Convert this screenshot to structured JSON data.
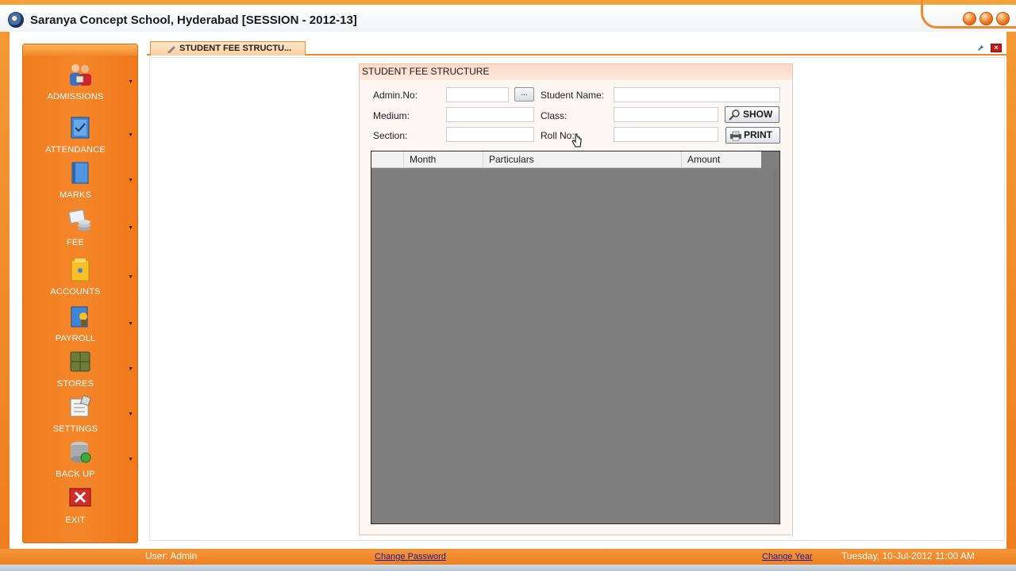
{
  "window": {
    "title": "Saranya Concept School, Hyderabad [SESSION - 2012-13]"
  },
  "sidebar": {
    "items": [
      {
        "label": "ADMISSIONS",
        "icon": "people-icon"
      },
      {
        "label": "ATTENDANCE",
        "icon": "attendance-book-icon"
      },
      {
        "label": "MARKS",
        "icon": "marks-book-icon"
      },
      {
        "label": "FEE",
        "icon": "fee-coins-icon"
      },
      {
        "label": "ACCOUNTS",
        "icon": "accounts-folder-icon"
      },
      {
        "label": "PAYROLL",
        "icon": "payroll-icon"
      },
      {
        "label": "STORES",
        "icon": "stores-cabinet-icon"
      },
      {
        "label": "SETTINGS",
        "icon": "settings-icon"
      },
      {
        "label": "BACK UP",
        "icon": "backup-database-icon"
      },
      {
        "label": "EXIT",
        "icon": "exit-icon"
      }
    ]
  },
  "tabs": [
    {
      "label": "STUDENT FEE STRUCTU..."
    }
  ],
  "form": {
    "title": "STUDENT FEE STRUCTURE",
    "admin_no_label": "Admin.No:",
    "admin_no_value": "",
    "browse_label": "...",
    "student_name_label": "Student Name:",
    "student_name_value": "",
    "medium_label": "Medium:",
    "medium_value": "",
    "class_label": "Class:",
    "class_value": "",
    "section_label": "Section:",
    "section_value": "",
    "roll_no_label": "Roll No:",
    "roll_no_value": "",
    "show_label": "SHOW",
    "print_label": "PRINT"
  },
  "grid": {
    "columns": [
      "Month",
      "Particulars",
      "Amount"
    ],
    "rows": []
  },
  "status": {
    "user": "User: Admin",
    "change_password": "Change Password",
    "change_year": "Change Year",
    "datetime": "Tuesday, 10-Jul-2012 11:00 AM"
  },
  "colors": {
    "accent_orange": "#f07d1d",
    "grid_background": "#7f7f7f",
    "panel_header": "#fbd9c8"
  }
}
